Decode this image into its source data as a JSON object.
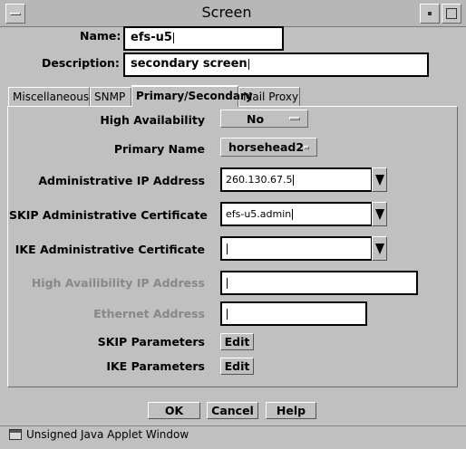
{
  "window": {
    "title": "Screen"
  },
  "form": {
    "name_label": "Name:",
    "name_value": "efs-u5",
    "description_label": "Description:",
    "description_value": "secondary screen"
  },
  "tabs": [
    {
      "label": "Miscellaneous"
    },
    {
      "label": "SNMP"
    },
    {
      "label": "Primary/Secondary"
    },
    {
      "label": "Mail Proxy"
    }
  ],
  "panel": {
    "high_availability": {
      "label": "High Availability",
      "value": "No"
    },
    "primary_name": {
      "label": "Primary Name",
      "value": "horsehead2"
    },
    "admin_ip": {
      "label": "Administrative IP Address",
      "value": "260.130.67.5"
    },
    "skip_admin_cert": {
      "label": "SKIP Administrative Certificate",
      "value": "efs-u5.admin"
    },
    "ike_admin_cert": {
      "label": "IKE Administrative Certificate",
      "value": ""
    },
    "ha_ip": {
      "label": "High Availibility IP Address",
      "value": ""
    },
    "ethernet": {
      "label": "Ethernet Address",
      "value": ""
    },
    "skip_params": {
      "label": "SKIP Parameters",
      "button": "Edit"
    },
    "ike_params": {
      "label": "IKE Parameters",
      "button": "Edit"
    }
  },
  "buttons": {
    "ok": "OK",
    "cancel": "Cancel",
    "help": "Help"
  },
  "status": {
    "text": "Unsigned Java Applet Window"
  }
}
